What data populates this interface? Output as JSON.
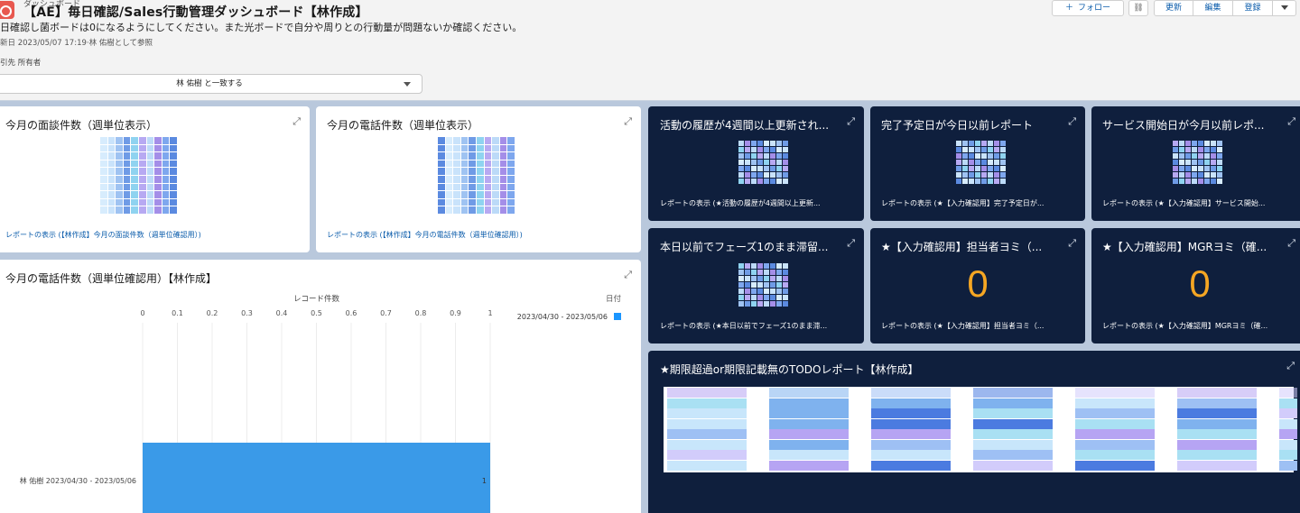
{
  "header": {
    "object_label": "ダッシュボード",
    "title": "【AE】毎日確認/Sales行動管理ダッシュボード【林作成】",
    "description": "日確認し菌ボードは0になるようにしてください。また光ボードで自分や周りとの行動量が問題ないか確認ください。",
    "meta": "新日 2023/05/07 17:19·林 佑樹として参照",
    "filter_label": "引先 所有者",
    "filter_value": "林 佑樹 と一致する",
    "buttons": {
      "follow": "フォロー",
      "refresh": "更新",
      "edit": "編集",
      "subscribe": "登録"
    }
  },
  "widgets": {
    "visits": {
      "title": "今月の面談件数（週単位表示）",
      "footer": "レポートの表示 (【林作成】今月の面談件数（週単位確認用）)"
    },
    "calls": {
      "title": "今月の電話件数（週単位表示）",
      "footer": "レポートの表示 (【林作成】今月の電話件数（週単位確認用）)"
    },
    "calls_chart": {
      "title": "今月の電話件数（週単位確認用）【林作成】"
    },
    "activity": {
      "title": "活動の履歴が4週間以上更新され...",
      "footer": "レポートの表示 (★活動の履歴が4週間以上更新..."
    },
    "due": {
      "title": "完了予定日が今日以前レポート",
      "footer": "レポートの表示 (★【入力確認用】完了予定日が..."
    },
    "service": {
      "title": "サービス開始日が今月以前レポ...",
      "footer": "レポートの表示 (★【入力確認用】サービス開始..."
    },
    "phase1": {
      "title": "本日以前でフェーズ1のまま滞留...",
      "footer": "レポートの表示 (★本日以前でフェーズ1のまま滞..."
    },
    "owner_yomi": {
      "title": "★【入力確認用】担当者ヨミ（...",
      "value": "0",
      "footer": "レポートの表示 (★【入力確認用】担当者ヨミ（..."
    },
    "mgr_yomi": {
      "title": "★【入力確認用】MGRヨミ（確...",
      "value": "0",
      "footer": "レポートの表示 (★【入力確認用】MGRヨミ（確..."
    },
    "todo": {
      "title": "★期限超過or期限記載無のTODOレポート【林作成】"
    }
  },
  "chart_data": {
    "type": "bar",
    "orientation": "horizontal",
    "title": "今月の電話件数（週単位確認用）【林作成】",
    "xlabel": "レコード件数",
    "legend_title": "日付",
    "legend_placement": "top-right",
    "xlim": [
      0,
      1
    ],
    "x_ticks": [
      "0",
      "0.1",
      "0.2",
      "0.3",
      "0.4",
      "0.5",
      "0.6",
      "0.7",
      "0.8",
      "0.9",
      "1"
    ],
    "categories": [
      "林 佑樹   2023/04/30 - 2023/05/06"
    ],
    "series": [
      {
        "name": "2023/04/30 - 2023/05/06",
        "values": [
          1
        ],
        "data_labels": [
          "1"
        ]
      }
    ],
    "colors": {
      "bar": "#3a9ae8",
      "legend": "#1b96ff"
    }
  },
  "colors": {
    "accent": "#0b5cab",
    "dark_tile": "#0f1f3d",
    "metric": "#f5a623"
  },
  "icons": {
    "expand": "expand-icon",
    "share": "share-icon",
    "plus": "plus-icon",
    "caret": "chevron-down-icon"
  }
}
